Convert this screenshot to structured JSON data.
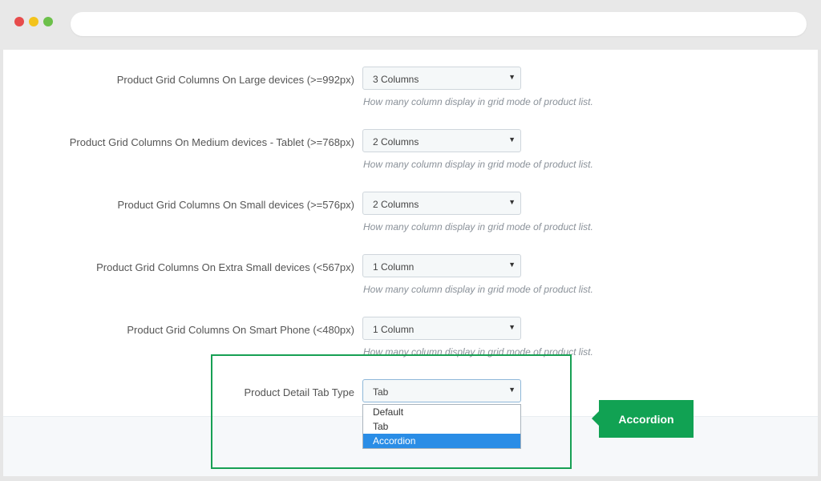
{
  "settings": [
    {
      "label": "Product Grid Columns On Large devices (>=992px)",
      "value": "3 Columns",
      "help": "How many column display in grid mode of product list."
    },
    {
      "label": "Product Grid Columns On Medium devices - Tablet (>=768px)",
      "value": "2 Columns",
      "help": "How many column display in grid mode of product list."
    },
    {
      "label": "Product Grid Columns On Small devices (>=576px)",
      "value": "2 Columns",
      "help": "How many column display in grid mode of product list."
    },
    {
      "label": "Product Grid Columns On Extra Small devices (<567px)",
      "value": "1 Column",
      "help": "How many column display in grid mode of product list."
    },
    {
      "label": "Product Grid Columns On Smart Phone (<480px)",
      "value": "1 Column",
      "help": "How many column display in grid mode of product list."
    }
  ],
  "tab_type": {
    "label": "Product Detail Tab Type",
    "value": "Tab",
    "options": [
      "Default",
      "Tab",
      "Accordion"
    ],
    "highlighted": "Accordion"
  },
  "callout": {
    "text": "Accordion"
  },
  "colors": {
    "accent_green": "#11a253",
    "selection_blue": "#2a8de6"
  }
}
